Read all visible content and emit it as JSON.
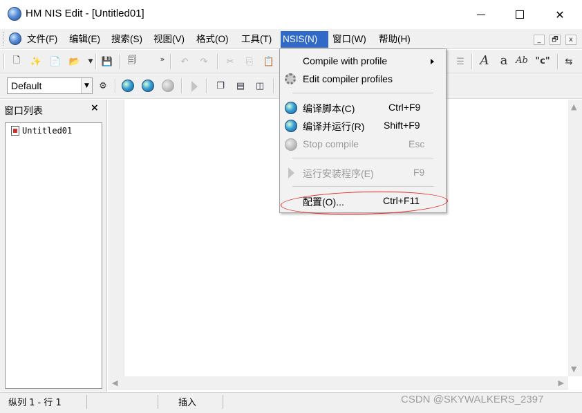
{
  "window": {
    "title": "HM NIS Edit - [Untitled01]",
    "min_glyph": "—",
    "max_glyph": "☐",
    "close_glyph": "✕"
  },
  "menubar": {
    "items": [
      "文件(F)",
      "编辑(E)",
      "搜索(S)",
      "视图(V)",
      "格式(O)",
      "工具(T)",
      "NSIS(N)",
      "窗口(W)",
      "帮助(H)"
    ],
    "active": "NSIS(N)",
    "mdi_buttons": [
      "_",
      "🗗",
      "x"
    ]
  },
  "toolbar2": {
    "profile_combo": "Default"
  },
  "toolbar_right": {
    "font_a": "A",
    "font_small_a": "a",
    "font_ab": "Ab",
    "quote_c": "\"c\""
  },
  "left_panel": {
    "title": "窗口列表",
    "close": "×",
    "files": [
      "Untitled01"
    ]
  },
  "nsis_menu": {
    "items": [
      {
        "label": "Compile with profile",
        "shortcut": "",
        "has_submenu": true,
        "enabled": true,
        "icon": "none"
      },
      {
        "label": "Edit compiler profiles",
        "shortcut": "",
        "enabled": true,
        "icon": "gear-icon"
      },
      {
        "label": "编译脚本(C)",
        "shortcut": "Ctrl+F9",
        "enabled": true,
        "icon": "compile-icon"
      },
      {
        "label": "编译并运行(R)",
        "shortcut": "Shift+F9",
        "enabled": true,
        "icon": "compile-run-icon"
      },
      {
        "label": "Stop compile",
        "shortcut": "Esc",
        "enabled": false,
        "icon": "stop-compile-icon"
      },
      {
        "label": "运行安装程序(E)",
        "shortcut": "F9",
        "enabled": false,
        "icon": "run-icon"
      },
      {
        "label": "配置(O)...",
        "shortcut": "Ctrl+F11",
        "enabled": true,
        "icon": "none"
      }
    ]
  },
  "annotation": {
    "highlight_color": "#e32020"
  },
  "status": {
    "position": "纵列 1 - 行 1",
    "mode": "插入"
  },
  "watermark": "CSDN @SKYWALKERS_2397"
}
